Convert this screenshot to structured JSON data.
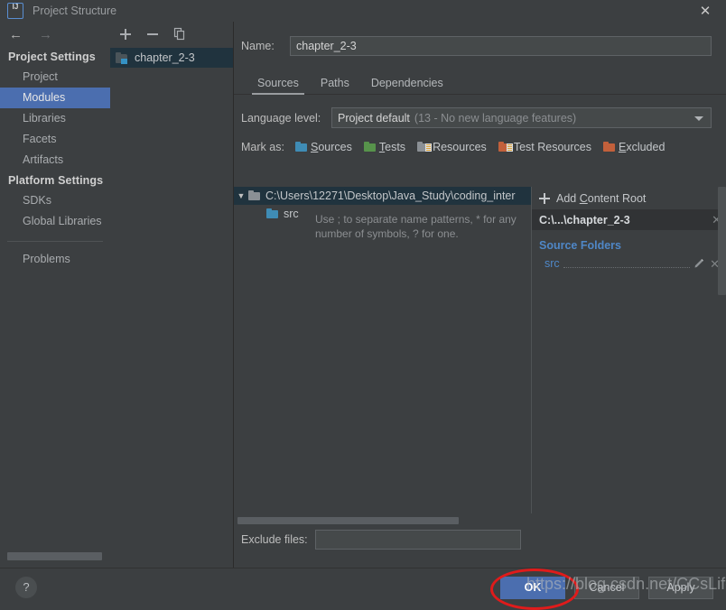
{
  "window": {
    "title": "Project Structure",
    "logo_text": "IJ",
    "close_label": "✕"
  },
  "nav": {
    "back_icon": "←",
    "forward_icon": "→",
    "groups": [
      {
        "heading": "Project Settings",
        "items": [
          {
            "label": "Project",
            "selected": false
          },
          {
            "label": "Modules",
            "selected": true
          },
          {
            "label": "Libraries",
            "selected": false
          },
          {
            "label": "Facets",
            "selected": false
          },
          {
            "label": "Artifacts",
            "selected": false
          }
        ]
      },
      {
        "heading": "Platform Settings",
        "items": [
          {
            "label": "SDKs",
            "selected": false
          },
          {
            "label": "Global Libraries",
            "selected": false
          }
        ]
      }
    ],
    "problems": "Problems"
  },
  "modules": {
    "toolbar": {
      "add": "+",
      "remove": "−",
      "copy": "copy-icon"
    },
    "items": [
      {
        "label": "chapter_2-3",
        "selected": true
      }
    ]
  },
  "name_field": {
    "label": "Name:",
    "value": "chapter_2-3"
  },
  "tabs": [
    {
      "label": "Sources",
      "active": true
    },
    {
      "label": "Paths",
      "active": false
    },
    {
      "label": "Dependencies",
      "active": false
    }
  ],
  "language_level": {
    "label": "Language level:",
    "value": "Project default",
    "hint": "(13 - No new language features)"
  },
  "mark_as": {
    "label": "Mark as:",
    "options": [
      {
        "label": "Sources",
        "mnemonic": "S",
        "rest": "ources",
        "color": "#3f8cb5",
        "icon": "folder-blue-icon"
      },
      {
        "label": "Tests",
        "mnemonic": "T",
        "rest": "ests",
        "color": "#57934b",
        "icon": "folder-green-icon"
      },
      {
        "label": "Resources",
        "mnemonic": "",
        "rest": "Resources",
        "color": "#8b9095",
        "icon": "folder-resources-icon"
      },
      {
        "label": "Test Resources",
        "mnemonic": "",
        "rest": "Test Resources",
        "color": "#c2603b",
        "icon": "folder-test-resources-icon"
      },
      {
        "label": "Excluded",
        "mnemonic": "E",
        "rest": "xcluded",
        "color": "#c2603b",
        "icon": "folder-orange-icon"
      }
    ]
  },
  "tree": {
    "root": {
      "twisty": "▼",
      "label": "C:\\Users\\12271\\Desktop\\Java_Study\\coding_inter",
      "selected": true
    },
    "children": [
      {
        "label": "src",
        "icon": "folder-blue-icon"
      }
    ]
  },
  "right_panel": {
    "add_content_root": {
      "prefix": "Add ",
      "mnemonic": "C",
      "suffix": "ontent Root"
    },
    "content_root": {
      "label": "C:\\...\\chapter_2-3",
      "close": "✕"
    },
    "source_folders_heading": "Source Folders",
    "source_folders": [
      {
        "name": "src",
        "edit": "pencil-icon",
        "remove": "✕"
      }
    ]
  },
  "exclude": {
    "label": "Exclude files:",
    "value": "",
    "hint": "Use ; to separate name patterns, * for any number of symbols, ? for one."
  },
  "footer": {
    "help": "?",
    "buttons": [
      {
        "label": "OK",
        "primary": true
      },
      {
        "label": "Cancel",
        "primary": false
      },
      {
        "label": "Apply",
        "primary": false
      }
    ]
  },
  "overlay": {
    "watermark": "https://blog.csdn.net/CCsLife",
    "annotation": "red-ellipse-around-ok-button"
  },
  "colors": {
    "window_bg": "#3c3f41",
    "selection_blue": "#4b6eaf",
    "tree_selection": "#20333e",
    "link_blue": "#4f87c7",
    "annotation_red": "#e01b1b"
  }
}
